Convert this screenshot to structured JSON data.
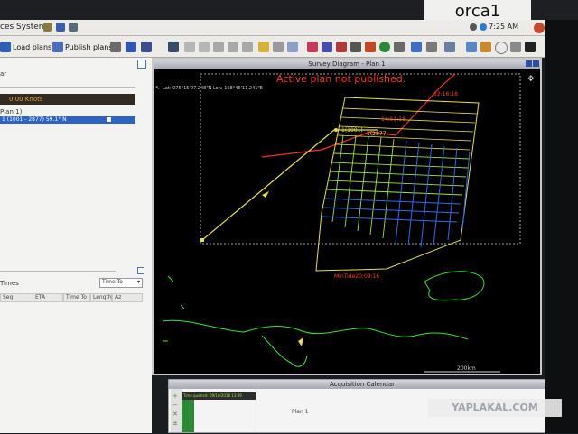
{
  "label_tag": "orca1",
  "menubar": {
    "places": "ces",
    "system": "System"
  },
  "clock": "7:25 AM",
  "toolbar": {
    "load_plans": "Load plans",
    "publish_plans": "Publish plans"
  },
  "left_panel": {
    "header_text": "ar",
    "speed": "0.00 Knots",
    "plan_label": "Plan 1)",
    "selected_line": "1 (1001 - 2877) 59.1° N",
    "times_label": "Times",
    "time_to_select": "Time To",
    "columns": [
      "Seq",
      "ETA",
      "Time To",
      "Length",
      "Az"
    ]
  },
  "survey": {
    "title": "Survey Diagram - Plan 1",
    "coord_readout": "Lat: 075°15'07.248\"N  Lon: 168°46'11.241\"E",
    "warning": "Active plan not published.",
    "label_time_top": "12:16:18",
    "label_time_mid": "14:51:18",
    "label_line": "1(1001)",
    "label_line_end": "1(2877)",
    "label_bottom": "MinTide20:09:16",
    "scale": "200km"
  },
  "acquisition": {
    "title": "Acquisition Calendar",
    "time_queried": "Time queried: 09/10/2018 13:49",
    "plan": "Plan 1",
    "vertical_label": "12/10/2018"
  },
  "watermark": "YAPLAKAL.COM",
  "colors": {
    "track_yellow": "#e8e23a",
    "warning_red": "#ff3322",
    "coast_green": "#2ee82e",
    "grid_green": "#9be83a",
    "grid_blue": "#2a6cf0"
  }
}
